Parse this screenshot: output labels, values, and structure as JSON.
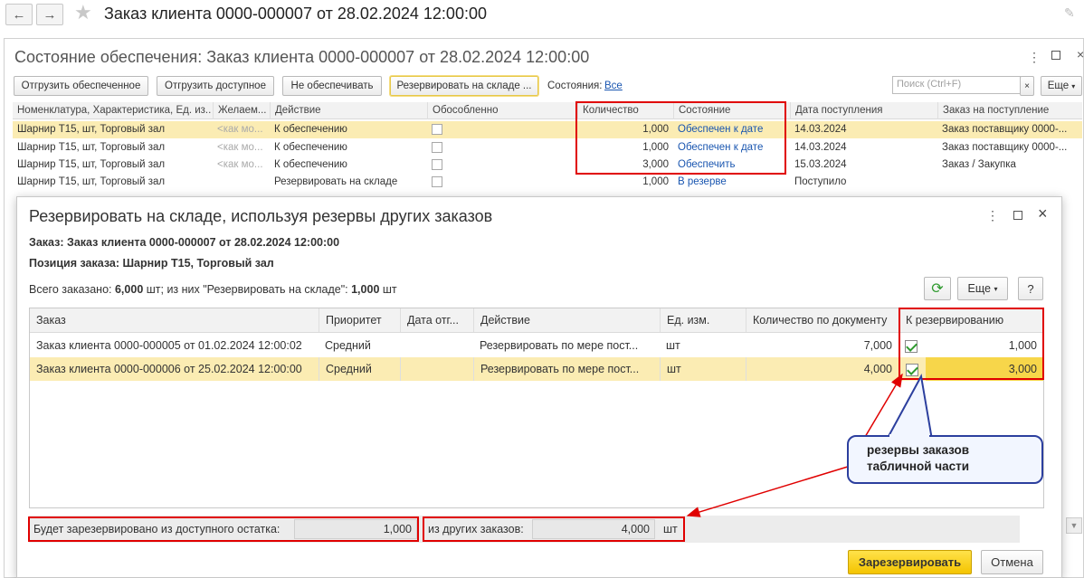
{
  "window": {
    "title": "Заказ клиента 0000-000007 от 28.02.2024 12:00:00"
  },
  "background_form": {
    "title": "Состояние обеспечения: Заказ клиента 0000-000007 от 28.02.2024 12:00:00",
    "buttons": [
      "Отгрузить обеспеченное",
      "Отгрузить доступное",
      "Не обеспечивать",
      "Резервировать на складе ..."
    ],
    "state_label": "Состояния:",
    "state_value": "Все",
    "search_placeholder": "Поиск (Ctrl+F)",
    "more_label": "Еще",
    "columns": [
      "Номенклатура, Характеристика, Ед. из...",
      "Желаем...",
      "Действие",
      "Обособленно",
      "Количество",
      "Состояние",
      "Дата поступления",
      "Заказ на поступление"
    ],
    "rows": [
      {
        "item": "Шарнир Т15, шт, Торговый зал",
        "wish": "<как мо...",
        "action": "К обеспечению",
        "qty": "1,000",
        "state": "Обеспечен к дате",
        "date": "14.03.2024",
        "order": "Заказ поставщику 0000-..."
      },
      {
        "item": "Шарнир Т15, шт, Торговый зал",
        "wish": "<как мо...",
        "action": "К обеспечению",
        "qty": "1,000",
        "state": "Обеспечен к дате",
        "date": "14.03.2024",
        "order": "Заказ поставщику 0000-..."
      },
      {
        "item": "Шарнир Т15, шт, Торговый зал",
        "wish": "<как мо...",
        "action": "К обеспечению",
        "qty": "3,000",
        "state": "Обеспечить",
        "date": "15.03.2024",
        "order": "Заказ / Закупка"
      },
      {
        "item": "Шарнир Т15, шт, Торговый зал",
        "wish": "",
        "action": "Резервировать на складе",
        "qty": "1,000",
        "state": "В резерве",
        "date": "Поступило",
        "order": ""
      }
    ]
  },
  "dialog": {
    "title": "Резервировать на складе, используя резервы других заказов",
    "order_line": "Заказ: Заказ клиента 0000-000007 от 28.02.2024 12:00:00",
    "position_line": "Позиция заказа: Шарнир Т15, Торговый зал",
    "total_prefix": "Всего заказано: ",
    "total_value": "6,000",
    "total_mid": " шт; из них \"Резервировать на складе\": ",
    "total_reserve": "1,000",
    "total_suffix": " шт",
    "more_label": "Еще",
    "help_label": "?",
    "columns": [
      "Заказ",
      "Приоритет",
      "Дата отг...",
      "Действие",
      "Ед. изм.",
      "Количество по документу",
      "К резервированию"
    ],
    "rows": [
      {
        "order": "Заказ клиента 0000-000005 от 01.02.2024 12:00:02",
        "priority": "Средний",
        "date": "",
        "action": "Резервировать по мере пост...",
        "unit": "шт",
        "qty": "7,000",
        "checked": true,
        "reserve": "1,000"
      },
      {
        "order": "Заказ клиента 0000-000006 от 25.02.2024 12:00:00",
        "priority": "Средний",
        "date": "",
        "action": "Резервировать по мере пост...",
        "unit": "шт",
        "qty": "4,000",
        "checked": true,
        "reserve": "3,000"
      }
    ],
    "footer": {
      "available_label": "Будет зарезервировано из доступного остатка:",
      "available_value": "1,000",
      "other_label": "из других заказов:",
      "other_value": "4,000",
      "unit": "шт"
    },
    "reserve_button": "Зарезервировать",
    "cancel_button": "Отмена"
  },
  "callout": {
    "text_line1": "резервы заказов",
    "text_line2": "табличной части"
  },
  "colors": {
    "highlight_row": "#fbecb3",
    "annotation_red": "#e00000",
    "callout_border": "#2c3f9e",
    "link": "#1a56b0",
    "primary_button": "#f4c400"
  }
}
